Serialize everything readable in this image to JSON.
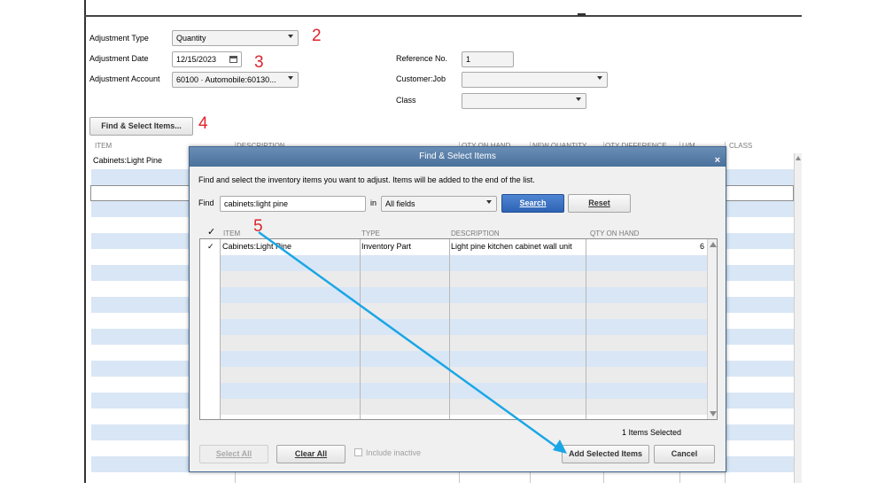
{
  "form": {
    "adjustment_type_label": "Adjustment Type",
    "adjustment_type_value": "Quantity",
    "adjustment_date_label": "Adjustment Date",
    "adjustment_date_value": "12/15/2023",
    "adjustment_account_label": "Adjustment Account",
    "adjustment_account_value": "60100 · Automobile:60130...",
    "reference_no_label": "Reference No.",
    "reference_no_value": "1",
    "customer_job_label": "Customer:Job",
    "customer_job_value": "",
    "class_label": "Class",
    "class_value": "",
    "find_select_button": "Find & Select Items..."
  },
  "annotations": [
    "2",
    "3",
    "4",
    "5"
  ],
  "bg_table": {
    "headers": [
      "ITEM",
      "DESCRIPTION",
      "QTY ON HAND",
      "NEW QUANTITY",
      "QTY DIFFERENCE",
      "U/M",
      "CLASS"
    ],
    "first_row_item": "Cabinets:Light Pine"
  },
  "dialog": {
    "title": "Find & Select Items",
    "close_icon": "×",
    "instructions": "Find and select the inventory items you want to adjust.  Items will be added to the end of the list.",
    "find_label": "Find",
    "find_value": "cabinets:light pine",
    "in_label": "in",
    "field_scope": "All fields",
    "search_button": "Search",
    "reset_button": "Reset",
    "columns": {
      "check": "✓",
      "item": "ITEM",
      "type": "TYPE",
      "description": "DESCRIPTION",
      "qty": "QTY ON HAND"
    },
    "rows": [
      {
        "check": "✓",
        "item": "Cabinets:Light Pine",
        "type": "Inventory Part",
        "description": "Light pine kitchen cabinet wall unit",
        "qty": "6"
      }
    ],
    "selected_count": "1 Items Selected",
    "select_all_button": "Select All",
    "clear_all_button": "Clear All",
    "include_inactive_label": "Include inactive",
    "add_selected_button": "Add Selected Items",
    "cancel_button": "Cancel"
  },
  "colors": {
    "annotation_red": "#e0242e",
    "arrow_blue": "#1aa6e6",
    "row_alt": "#d9e6f5",
    "title_bar": "#4a719c"
  }
}
